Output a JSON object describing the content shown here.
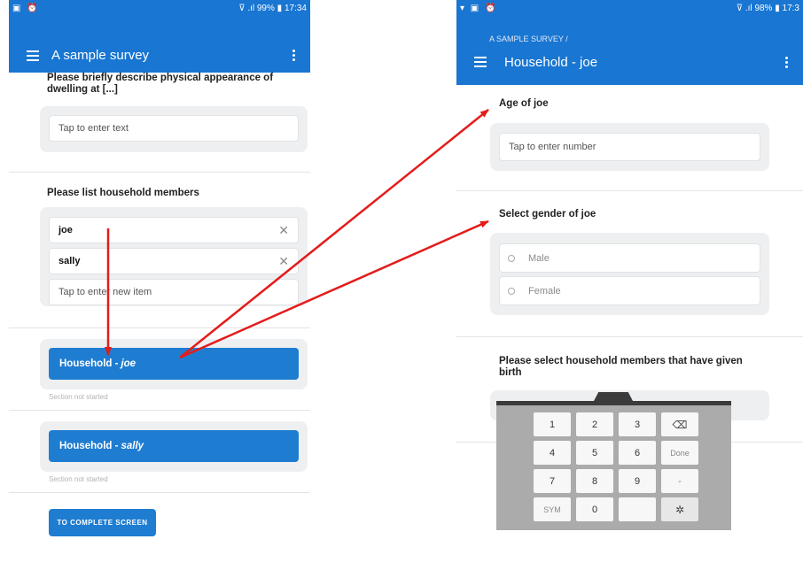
{
  "left_screen": {
    "status_bar": {
      "time": "17:34",
      "battery": "99%"
    },
    "app_bar": {
      "title": "A sample survey"
    },
    "questions": {
      "dwelling": {
        "label": "Please briefly describe physical appearance of dwelling at [...]",
        "placeholder": "Tap to enter text"
      },
      "members": {
        "label": "Please list household members",
        "items": [
          "joe",
          "sally"
        ],
        "new_item_placeholder": "Tap to enter new item"
      }
    },
    "sections": [
      {
        "label": "Household - ",
        "name": "joe",
        "status": "Section not started"
      },
      {
        "label": "Household - ",
        "name": "sally",
        "status": "Section not started"
      }
    ],
    "complete_button": "TO COMPLETE SCREEN"
  },
  "right_screen": {
    "status_bar": {
      "time": "17:3",
      "battery": "98%"
    },
    "app_bar": {
      "breadcrumb": "A SAMPLE SURVEY /",
      "title": "Household - joe"
    },
    "questions": {
      "age": {
        "label": "Age of joe",
        "placeholder": "Tap to enter number"
      },
      "gender": {
        "label": "Select gender of joe",
        "options": [
          "Male",
          "Female"
        ]
      },
      "birth": {
        "label": "Please select household members that have given birth"
      }
    },
    "keyboard": {
      "rows": [
        [
          "1",
          "2",
          "3",
          "backspace"
        ],
        [
          "4",
          "5",
          "6",
          "Done"
        ],
        [
          "7",
          "8",
          "9",
          "-"
        ],
        [
          "SYM",
          "0",
          "",
          "gear"
        ]
      ]
    }
  },
  "colors": {
    "primary": "#1976d2",
    "button": "#1f7dd1",
    "arrow": "#e41b1b"
  }
}
